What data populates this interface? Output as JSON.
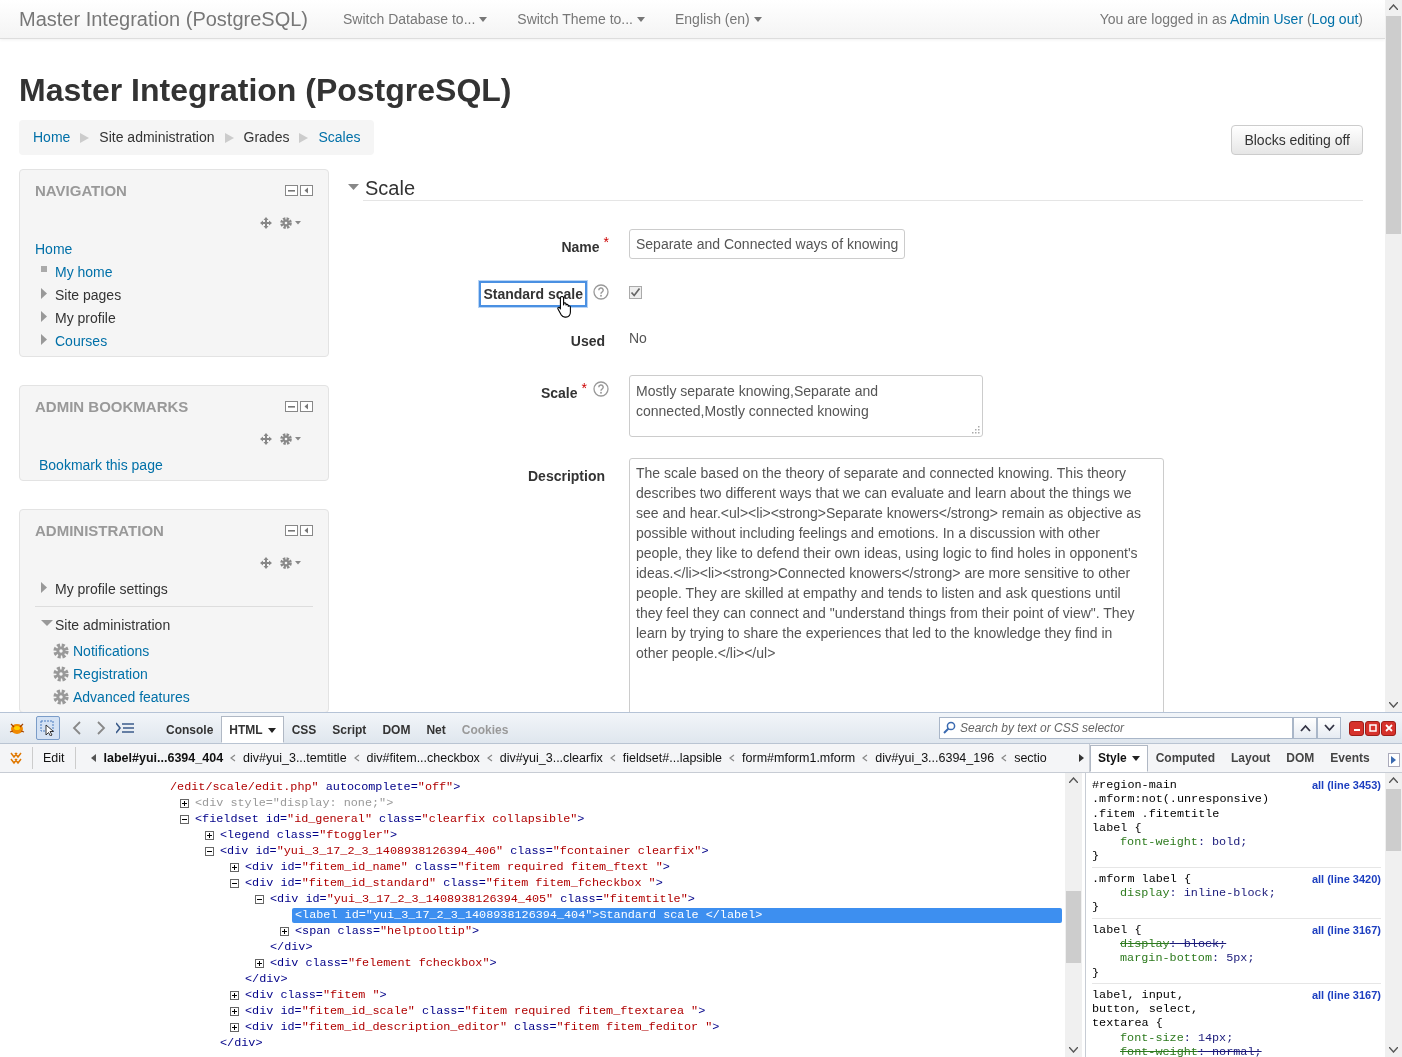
{
  "navbar": {
    "brand": "Master Integration (PostgreSQL)",
    "menus": [
      "Switch Database to...",
      "Switch Theme to...",
      "English (en)"
    ],
    "login": {
      "prefix": "You are logged in as",
      "user": "Admin User",
      "open": "(",
      "logout": "Log out",
      "close": ")"
    }
  },
  "page_title": "Master Integration (PostgreSQL)",
  "breadcrumb": [
    {
      "label": "Home",
      "link": true
    },
    {
      "label": "Site administration",
      "link": false
    },
    {
      "label": "Grades",
      "link": false
    },
    {
      "label": "Scales",
      "link": true
    }
  ],
  "blocks_button": "Blocks editing off",
  "blocks": [
    {
      "title": "NAVIGATION",
      "items": [
        {
          "label": "Home",
          "kind": "root",
          "link": true,
          "children": [
            {
              "label": "My home",
              "kind": "leaf",
              "link": true
            },
            {
              "label": "Site pages",
              "kind": "branch",
              "link": false,
              "expanded": false
            },
            {
              "label": "My profile",
              "kind": "branch",
              "link": false,
              "expanded": false
            },
            {
              "label": "Courses",
              "kind": "branch",
              "link": true,
              "expanded": false
            }
          ]
        }
      ]
    },
    {
      "title": "ADMIN BOOKMARKS",
      "items": [
        {
          "label": "Bookmark this page",
          "kind": "root",
          "link": true
        }
      ]
    },
    {
      "title": "ADMINISTRATION",
      "items": [
        {
          "label": "My profile settings",
          "kind": "branch",
          "link": false,
          "expanded": false
        },
        {
          "label": "Site administration",
          "kind": "branch",
          "link": false,
          "expanded": true,
          "children": [
            {
              "label": "Notifications",
              "kind": "gear",
              "link": true
            },
            {
              "label": "Registration",
              "kind": "gear",
              "link": true
            },
            {
              "label": "Advanced features",
              "kind": "gear",
              "link": true
            }
          ]
        }
      ]
    }
  ],
  "form": {
    "legend": "Scale",
    "expanded": true,
    "fields": [
      {
        "kind": "text",
        "label": "Name",
        "required_mark": "*",
        "value": "Separate and Connected ways of knowing"
      },
      {
        "kind": "checkbox",
        "label": "Standard scale",
        "help": true,
        "checked": true,
        "highlighted": true
      },
      {
        "kind": "static",
        "label": "Used",
        "value": "No"
      },
      {
        "kind": "textarea",
        "label": "Scale",
        "required_mark": "*",
        "help": true,
        "value": "Mostly separate knowing,Separate and connected,Mostly connected knowing"
      },
      {
        "kind": "editor",
        "label": "Description",
        "value": "The scale based on the theory of separate and connected knowing. This theory describes two different ways that we can evaluate and learn about the things we see and hear.<ul><li><strong>Separate knowers</strong> remain as objective as possible without including feelings and emotions. In a discussion with other people, they like to defend their own ideas, using logic to find holes in opponent's ideas.</li><li><strong>Connected knowers</strong> are more sensitive to other people. They are skilled at empathy and tends to listen and ask questions until they feel they can connect and \"understand things from their point of view\". They learn by trying to share the experiences that led to the knowledge they find in other people.</li></ul>"
      }
    ]
  },
  "firebug": {
    "tabs": [
      {
        "label": "Console",
        "selected": false,
        "disabled": false
      },
      {
        "label": "HTML",
        "selected": true,
        "disabled": false
      },
      {
        "label": "CSS",
        "selected": false,
        "disabled": false
      },
      {
        "label": "Script",
        "selected": false,
        "disabled": false
      },
      {
        "label": "DOM",
        "selected": false,
        "disabled": false
      },
      {
        "label": "Net",
        "selected": false,
        "disabled": false
      },
      {
        "label": "Cookies",
        "selected": false,
        "disabled": true
      }
    ],
    "search": {
      "placeholder": "Search by text or CSS selector"
    },
    "edit_button": "Edit",
    "path": [
      {
        "label": "label#yui...6394_404",
        "selected": true
      },
      {
        "label": "div#yui_3...temtitle",
        "selected": false
      },
      {
        "label": "div#fitem...checkbox",
        "selected": false
      },
      {
        "label": "div#yui_3...clearfix",
        "selected": false
      },
      {
        "label": "fieldset#...lapsible",
        "selected": false
      },
      {
        "label": "form#mform1.mform",
        "selected": false
      },
      {
        "label": "div#yui_3...6394_196",
        "selected": false
      },
      {
        "label": "sectio",
        "selected": false
      }
    ],
    "side_tabs": [
      {
        "label": "Style",
        "selected": true
      },
      {
        "label": "Computed",
        "selected": false
      },
      {
        "label": "Layout",
        "selected": false
      },
      {
        "label": "DOM",
        "selected": false
      },
      {
        "label": "Events",
        "selected": false
      }
    ],
    "html_tree": [
      {
        "selected": false,
        "line": [
          {
            "kind": "value",
            "text": "/edit/scale/edit.php\""
          },
          {
            "kind": "attr",
            "text": " autocomplete="
          },
          {
            "kind": "value",
            "text": "\"off\""
          },
          {
            "kind": "tag",
            "text": ">"
          }
        ],
        "children": [
          {
            "expanded": false,
            "selected": false,
            "line": [
              {
                "kind": "dim",
                "text": "<div style=\"display: none;\">"
              }
            ]
          },
          {
            "expanded": true,
            "selected": false,
            "line": [
              {
                "kind": "tag",
                "text": "<fieldset"
              },
              {
                "kind": "attr",
                "text": " id="
              },
              {
                "kind": "value",
                "text": "\"id_general\""
              },
              {
                "kind": "attr",
                "text": " class="
              },
              {
                "kind": "value",
                "text": "\"clearfix collapsible\""
              },
              {
                "kind": "tag",
                "text": ">"
              }
            ],
            "children": [
              {
                "expanded": false,
                "selected": false,
                "line": [
                  {
                    "kind": "tag",
                    "text": "<legend"
                  },
                  {
                    "kind": "attr",
                    "text": " class="
                  },
                  {
                    "kind": "value",
                    "text": "\"ftoggler\""
                  },
                  {
                    "kind": "tag",
                    "text": ">"
                  }
                ]
              },
              {
                "expanded": true,
                "selected": false,
                "line": [
                  {
                    "kind": "tag",
                    "text": "<div"
                  },
                  {
                    "kind": "attr",
                    "text": " id="
                  },
                  {
                    "kind": "value",
                    "text": "\"yui_3_17_2_3_1408938126394_406\""
                  },
                  {
                    "kind": "attr",
                    "text": " class="
                  },
                  {
                    "kind": "value",
                    "text": "\"fcontainer clearfix\""
                  },
                  {
                    "kind": "tag",
                    "text": ">"
                  }
                ],
                "children": [
                  {
                    "expanded": false,
                    "selected": false,
                    "line": [
                      {
                        "kind": "tag",
                        "text": "<div"
                      },
                      {
                        "kind": "attr",
                        "text": " id="
                      },
                      {
                        "kind": "value",
                        "text": "\"fitem_id_name\""
                      },
                      {
                        "kind": "attr",
                        "text": " class="
                      },
                      {
                        "kind": "value",
                        "text": "\"fitem required fitem_ftext \""
                      },
                      {
                        "kind": "tag",
                        "text": ">"
                      }
                    ]
                  },
                  {
                    "expanded": true,
                    "selected": false,
                    "line": [
                      {
                        "kind": "tag",
                        "text": "<div"
                      },
                      {
                        "kind": "attr",
                        "text": " id="
                      },
                      {
                        "kind": "value",
                        "text": "\"fitem_id_standard\""
                      },
                      {
                        "kind": "attr",
                        "text": " class="
                      },
                      {
                        "kind": "value",
                        "text": "\"fitem fitem_fcheckbox \""
                      },
                      {
                        "kind": "tag",
                        "text": ">"
                      }
                    ],
                    "children": [
                      {
                        "expanded": true,
                        "selected": false,
                        "line": [
                          {
                            "kind": "tag",
                            "text": "<div"
                          },
                          {
                            "kind": "attr",
                            "text": " id="
                          },
                          {
                            "kind": "value",
                            "text": "\"yui_3_17_2_3_1408938126394_405\""
                          },
                          {
                            "kind": "attr",
                            "text": " class="
                          },
                          {
                            "kind": "value",
                            "text": "\"fitemtitle\""
                          },
                          {
                            "kind": "tag",
                            "text": ">"
                          }
                        ],
                        "children": [
                          {
                            "selected": true,
                            "line": [
                              {
                                "kind": "tag",
                                "text": "<label"
                              },
                              {
                                "kind": "attr",
                                "text": " id="
                              },
                              {
                                "kind": "value",
                                "text": "\"yui_3_17_2_3_1408938126394_404\""
                              },
                              {
                                "kind": "tag",
                                "text": ">"
                              },
                              {
                                "kind": "text",
                                "text": "Standard scale "
                              },
                              {
                                "kind": "tag",
                                "text": "</label>"
                              }
                            ]
                          },
                          {
                            "expanded": false,
                            "selected": false,
                            "line": [
                              {
                                "kind": "tag",
                                "text": "<span"
                              },
                              {
                                "kind": "attr",
                                "text": " class="
                              },
                              {
                                "kind": "value",
                                "text": "\"helptooltip\""
                              },
                              {
                                "kind": "tag",
                                "text": ">"
                              }
                            ]
                          }
                        ],
                        "close": [
                          {
                            "kind": "tag",
                            "text": "</div>"
                          }
                        ]
                      },
                      {
                        "expanded": false,
                        "selected": false,
                        "line": [
                          {
                            "kind": "tag",
                            "text": "<div"
                          },
                          {
                            "kind": "attr",
                            "text": " class="
                          },
                          {
                            "kind": "value",
                            "text": "\"felement fcheckbox\""
                          },
                          {
                            "kind": "tag",
                            "text": ">"
                          }
                        ]
                      }
                    ],
                    "close": [
                      {
                        "kind": "tag",
                        "text": "</div>"
                      }
                    ]
                  },
                  {
                    "expanded": false,
                    "selected": false,
                    "line": [
                      {
                        "kind": "tag",
                        "text": "<div"
                      },
                      {
                        "kind": "attr",
                        "text": " class="
                      },
                      {
                        "kind": "value",
                        "text": "\"fitem \""
                      },
                      {
                        "kind": "tag",
                        "text": ">"
                      }
                    ]
                  },
                  {
                    "expanded": false,
                    "selected": false,
                    "line": [
                      {
                        "kind": "tag",
                        "text": "<div"
                      },
                      {
                        "kind": "attr",
                        "text": " id="
                      },
                      {
                        "kind": "value",
                        "text": "\"fitem_id_scale\""
                      },
                      {
                        "kind": "attr",
                        "text": " class="
                      },
                      {
                        "kind": "value",
                        "text": "\"fitem required fitem_ftextarea \""
                      },
                      {
                        "kind": "tag",
                        "text": ">"
                      }
                    ]
                  },
                  {
                    "expanded": false,
                    "selected": false,
                    "line": [
                      {
                        "kind": "tag",
                        "text": "<div"
                      },
                      {
                        "kind": "attr",
                        "text": " id="
                      },
                      {
                        "kind": "value",
                        "text": "\"fitem_id_description_editor\""
                      },
                      {
                        "kind": "attr",
                        "text": " class="
                      },
                      {
                        "kind": "value",
                        "text": "\"fitem fitem_feditor \""
                      },
                      {
                        "kind": "tag",
                        "text": ">"
                      }
                    ]
                  }
                ],
                "close": [
                  {
                    "kind": "tag",
                    "text": "</div>"
                  }
                ]
              }
            ]
          }
        ]
      }
    ],
    "style_rules": [
      {
        "selector": [
          "#region-main",
          ".mform:not(.unresponsive)",
          ".fitem .fitemtitle",
          "label {"
        ],
        "source": "all (line 3453)",
        "props": [
          {
            "name": "font-weight",
            "rest": ": bold;",
            "overridden": false
          }
        ],
        "close": "}"
      },
      {
        "selector": [
          ".mform label {"
        ],
        "source": "all (line 3420)",
        "props": [
          {
            "name": "display",
            "rest": ": inline-block;",
            "overridden": false
          }
        ],
        "close": "}"
      },
      {
        "selector": [
          "label {"
        ],
        "source": "all (line 3167)",
        "props": [
          {
            "name": "display",
            "rest": ": block;",
            "overridden": true
          },
          {
            "name": "margin-bottom",
            "rest": ": 5px;",
            "overridden": false
          }
        ],
        "close": "}"
      },
      {
        "selector": [
          "label, input,",
          "button, select,",
          "textarea {"
        ],
        "source": "all (line 3167)",
        "props": [
          {
            "name": "font-size",
            "rest": ": 14px;",
            "overridden": false
          },
          {
            "name": "font-weight",
            "rest": ": normal;",
            "overridden": true
          }
        ]
      }
    ]
  }
}
